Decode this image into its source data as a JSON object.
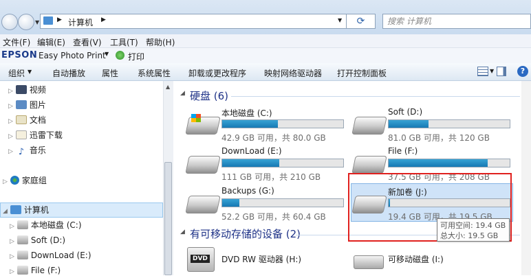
{
  "address": {
    "path": "计算机",
    "search_placeholder": "搜索 计算机"
  },
  "menu": [
    "文件(F)",
    "编辑(E)",
    "查看(V)",
    "工具(T)",
    "帮助(H)"
  ],
  "epson": {
    "brand": "EPSON",
    "app": "Easy Photo Print",
    "print": "打印"
  },
  "commands": [
    "组织",
    "自动播放",
    "属性",
    "系统属性",
    "卸载或更改程序",
    "映射网络驱动器",
    "打开控制面板"
  ],
  "nav": {
    "libraries": [
      "视频",
      "图片",
      "文档",
      "迅雷下载",
      "音乐"
    ],
    "homegroup": "家庭组",
    "computer": "计算机",
    "drives": [
      "本地磁盘 (C:)",
      "Soft (D:)",
      "DownLoad (E:)",
      "File (F:)"
    ]
  },
  "sections": {
    "hdd": "硬盘 (6)",
    "removable": "有可移动存储的设备 (2)"
  },
  "drives": [
    {
      "name": "本地磁盘 (C:)",
      "usage": "42.9 GB 可用，共 80.0 GB",
      "used_fraction": 0.46
    },
    {
      "name": "Soft (D:)",
      "usage": "81.0 GB 可用，共 120 GB",
      "used_fraction": 0.33
    },
    {
      "name": "DownLoad (E:)",
      "usage": "111 GB 可用，共 210 GB",
      "used_fraction": 0.47
    },
    {
      "name": "File (F:)",
      "usage": "37.5 GB 可用，共 208 GB",
      "used_fraction": 0.82
    },
    {
      "name": "Backups (G:)",
      "usage": "52.2 GB 可用，共 60.4 GB",
      "used_fraction": 0.14
    },
    {
      "name": "新加卷 (J:)",
      "usage": "19.4 GB 可用，共 19.5 GB",
      "used_fraction": 0.01
    }
  ],
  "removable": [
    {
      "name": "DVD RW 驱动器 (H:)",
      "icon_label": "DVD"
    },
    {
      "name": "可移动磁盘 (I:)"
    }
  ],
  "tooltip": {
    "free": "可用空间: 19.4 GB",
    "total": "总大小: 19.5 GB"
  },
  "colors": {
    "bar": "#26a0da",
    "highlight": "#cfe3f8",
    "annotation": "#e0201e"
  }
}
